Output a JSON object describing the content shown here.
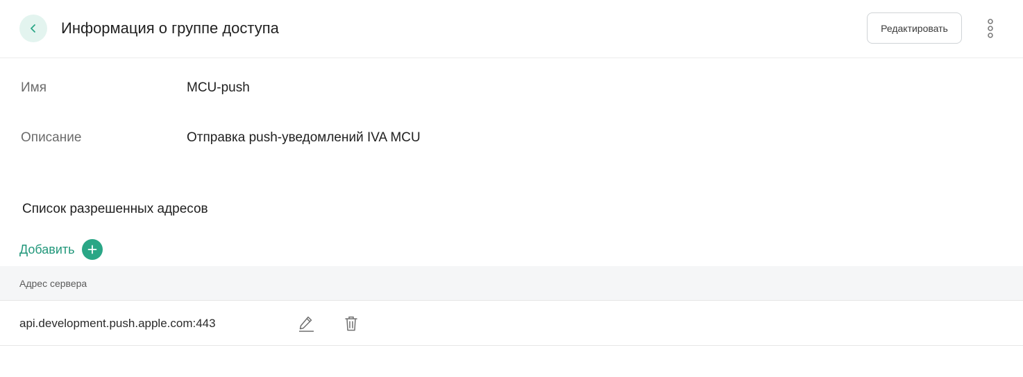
{
  "header": {
    "title": "Информация о группе доступа",
    "edit_label": "Редактировать",
    "accent_color": "#2aa686"
  },
  "details": {
    "name_label": "Имя",
    "name_value": "MCU-push",
    "description_label": "Описание",
    "description_value": "Отправка push-уведомлений IVA MCU"
  },
  "addresses": {
    "title": "Список разрешенных адресов",
    "add_label": "Добавить",
    "columns": [
      "Адрес сервера"
    ],
    "rows": [
      {
        "address": "api.development.push.apple.com:443"
      }
    ]
  },
  "icons": {
    "back": "chevron-left-icon",
    "more": "more-vertical-icon",
    "add": "plus-circle-icon",
    "edit": "pencil-icon",
    "delete": "trash-icon"
  }
}
